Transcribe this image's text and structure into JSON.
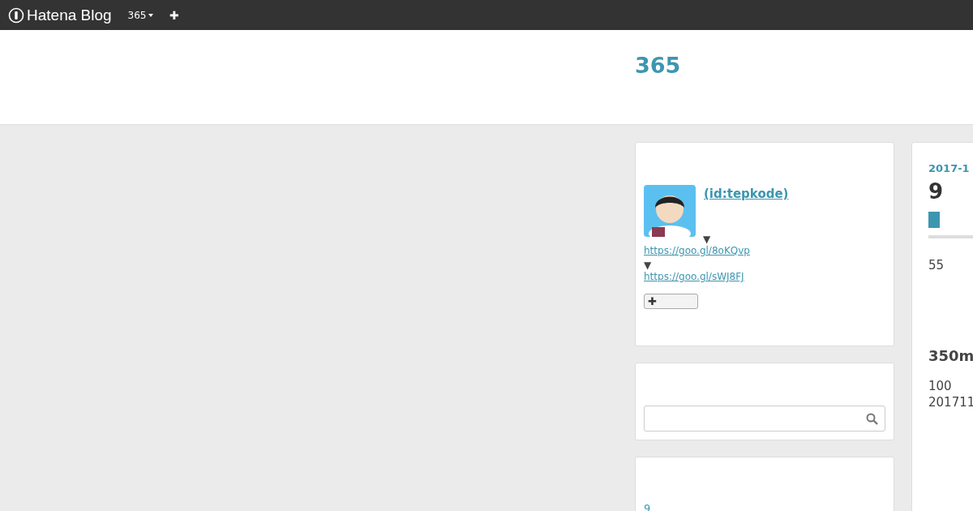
{
  "topbar": {
    "logo": "Hatena Blog",
    "blog_menu": "365",
    "add_button": "✚"
  },
  "blog_title": "365",
  "sidebar": {
    "profile": {
      "user": " (id:tepkode)",
      "links": [
        {
          "arrow": "▼",
          "url": "https://goo.gl/8oKQvp"
        },
        {
          "arrow": "▼",
          "url": "https://goo.gl/sWJ8FJ"
        }
      ],
      "follow_button": "✚"
    },
    "archive": {
      "first_item": "9"
    }
  },
  "entry": {
    "date": "2017-1",
    "title": "9",
    "body_1": "55",
    "heading": "350m",
    "body_2": "100",
    "body_3": "201711"
  }
}
